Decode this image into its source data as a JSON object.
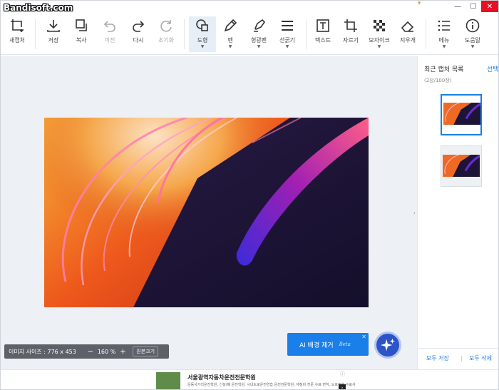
{
  "app": {
    "watermark": "Bandisoft.com",
    "window_controls": {
      "minimize": "—",
      "maximize": "☐",
      "close": "✕"
    }
  },
  "toolbar": {
    "items": [
      {
        "id": "new-capture",
        "label": "새캡처",
        "icon": "crop-plus-icon",
        "enabled": true
      },
      {
        "id": "save",
        "label": "저장",
        "icon": "download-icon",
        "enabled": true
      },
      {
        "id": "copy",
        "label": "복사",
        "icon": "copy-icon",
        "enabled": true
      },
      {
        "id": "undo",
        "label": "이전",
        "icon": "undo-icon",
        "enabled": false
      },
      {
        "id": "redo",
        "label": "다시",
        "icon": "redo-icon",
        "enabled": true
      },
      {
        "id": "reset",
        "label": "초기화",
        "icon": "refresh-icon",
        "enabled": false
      },
      {
        "id": "shape",
        "label": "도형",
        "icon": "shapes-icon",
        "enabled": true,
        "active": true
      },
      {
        "id": "pen",
        "label": "펜",
        "icon": "pen-icon",
        "enabled": true
      },
      {
        "id": "highlighter",
        "label": "형광펜",
        "icon": "highlighter-icon",
        "enabled": true
      },
      {
        "id": "line-width",
        "label": "선굵기",
        "icon": "line-width-icon",
        "enabled": true
      },
      {
        "id": "text",
        "label": "텍스트",
        "icon": "text-icon",
        "enabled": true
      },
      {
        "id": "crop",
        "label": "자르기",
        "icon": "crop-icon",
        "enabled": true
      },
      {
        "id": "mosaic",
        "label": "모자이크",
        "icon": "mosaic-icon",
        "enabled": true
      },
      {
        "id": "eraser",
        "label": "지우개",
        "icon": "eraser-icon",
        "enabled": true
      },
      {
        "id": "menu",
        "label": "메뉴",
        "icon": "menu-icon",
        "enabled": true
      },
      {
        "id": "help",
        "label": "도움말",
        "icon": "info-icon",
        "enabled": true
      }
    ]
  },
  "canvas": {
    "image_size_label": "이미지 사이즈 : 776 x 453",
    "zoom_minus": "−",
    "zoom_value": "160 %",
    "zoom_plus": "+",
    "original_size_label": "원본크기",
    "ai_button_label": "AI 배경 제거",
    "ai_button_badge": "Beta",
    "ai_close": "✕"
  },
  "panel": {
    "title": "최근 캡처 목록",
    "select_label": "선택",
    "count": "(2장/100장)",
    "thumbnails": [
      {
        "name": "capture-1",
        "selected": true
      },
      {
        "name": "capture-2",
        "selected": false
      }
    ],
    "save_all": "모두 저장",
    "separator": "|",
    "delete_all": "모두 삭제"
  },
  "ad": {
    "title": "서울광역자동차운전전문학원",
    "desc": "운동사거리운전학원, 신설/폐 운전학원, 시내도로운전연습 운전전문학원, 재정비 전문 수료 면허, 도로주행 수료서",
    "info": "ⓘ",
    "arrow": "›"
  },
  "colors": {
    "accent": "#1a7fe8",
    "canvas_bg": "#edf0f4",
    "info_bar": "#5d6168",
    "close_red": "#e81123"
  }
}
